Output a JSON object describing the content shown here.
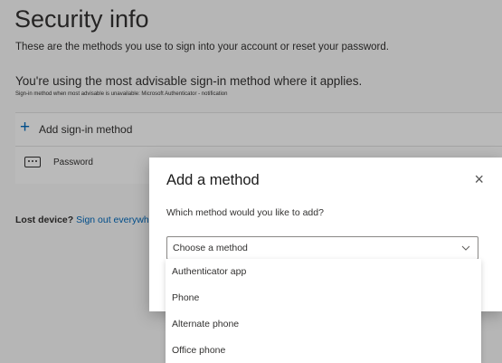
{
  "page": {
    "title": "Security info",
    "description": "These are the methods you use to sign into your account or reset your password.",
    "advisable": "You're using the most advisable sign-in method where it applies.",
    "advisable_sub": "Sign-in method when most advisable is unavailable: Microsoft Authenticator - notification"
  },
  "methods": {
    "add_label": "Add sign-in method",
    "password_label": "Password"
  },
  "lost_device": {
    "label": "Lost device?",
    "link": "Sign out everywh"
  },
  "dialog": {
    "title": "Add a method",
    "close_glyph": "×",
    "question": "Which method would you like to add?",
    "select_placeholder": "Choose a method",
    "options": [
      "Authenticator app",
      "Phone",
      "Alternate phone",
      "Office phone"
    ]
  },
  "icons": [
    "plus-icon",
    "password-dots-icon",
    "close-icon",
    "chevron-down-icon"
  ],
  "colors": {
    "accent": "#0067b8",
    "background": "#f3f3f3",
    "dialog": "#ffffff"
  }
}
